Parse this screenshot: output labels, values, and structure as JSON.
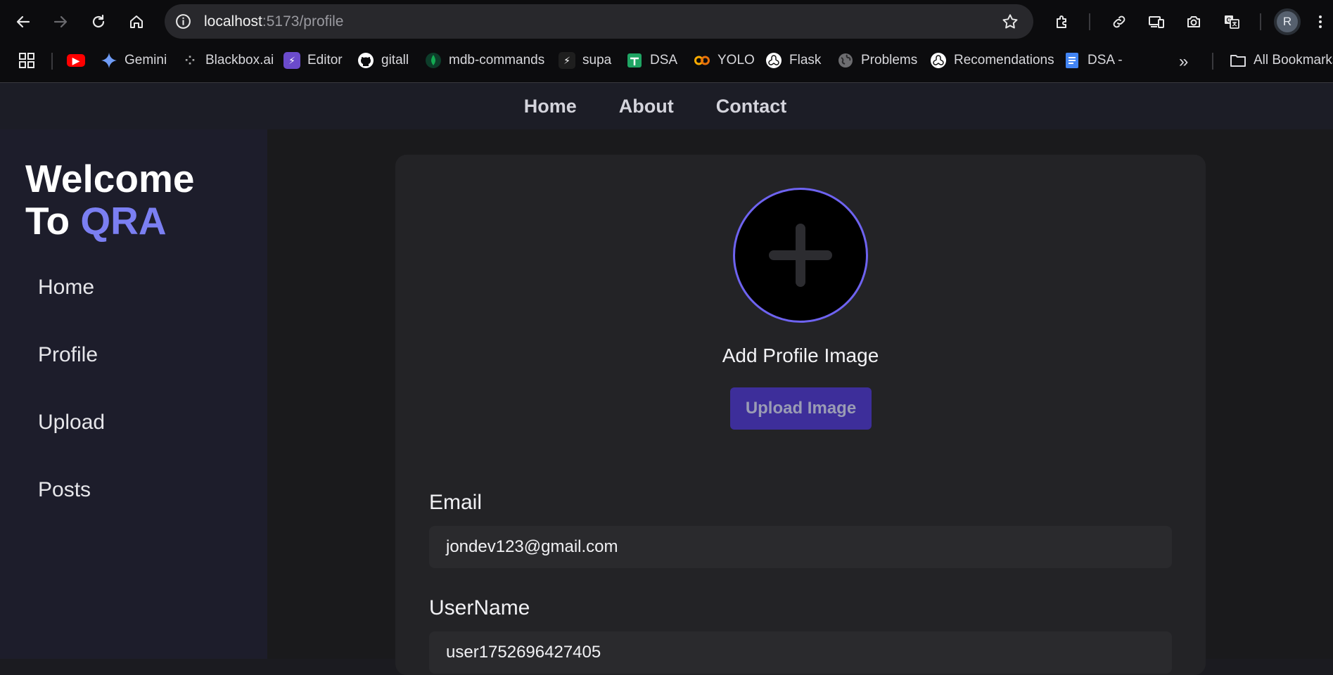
{
  "browser": {
    "url_host": "localhost",
    "url_path": ":5173/profile",
    "avatar_letter": "R",
    "bookmarks": [
      {
        "label": "",
        "icon": "youtube-icon",
        "color": "#ff0000"
      },
      {
        "label": "Gemini",
        "icon": "gemini-icon",
        "color": "#4c8df6"
      },
      {
        "label": "Blackbox.ai",
        "icon": "blackbox-icon",
        "color": "#3a3a3a"
      },
      {
        "label": "Editor",
        "icon": "editor-icon",
        "color": "#6b4bcc"
      },
      {
        "label": "gitall",
        "icon": "github-icon",
        "color": "#ffffff"
      },
      {
        "label": "mdb-commands",
        "icon": "mongodb-icon",
        "color": "#0b5e3a"
      },
      {
        "label": "supa",
        "icon": "supa-icon",
        "color": "#222222"
      },
      {
        "label": "DSA",
        "icon": "sheets-icon",
        "color": "#1fa463"
      },
      {
        "label": "YOLO",
        "icon": "colab-icon",
        "color": "#f9ab00"
      },
      {
        "label": "Flask",
        "icon": "openai-icon",
        "color": "#ffffff"
      },
      {
        "label": "Problems",
        "icon": "globe-icon",
        "color": "#888888"
      },
      {
        "label": "Recomendations",
        "icon": "openai-icon",
        "color": "#ffffff"
      },
      {
        "label": "DSA -",
        "icon": "docs-icon",
        "color": "#4285f4"
      }
    ],
    "more_label": "»",
    "all_bookmarks": "All Bookmarks"
  },
  "topnav": {
    "items": [
      "Home",
      "About",
      "Contact"
    ]
  },
  "sidebar": {
    "welcome_line1": "Welcome",
    "welcome_to": "To ",
    "welcome_brand": "QRA",
    "items": [
      "Home",
      "Profile",
      "Upload",
      "Posts"
    ]
  },
  "profile": {
    "add_image_label": "Add Profile Image",
    "upload_button": "Upload Image",
    "email_label": "Email",
    "email_value": "jondev123@gmail.com",
    "username_label": "UserName",
    "username_value": "user1752696427405"
  },
  "colors": {
    "accent": "#7b7ff2",
    "button": "#3d2e9a",
    "ring": "#6e63f0"
  }
}
